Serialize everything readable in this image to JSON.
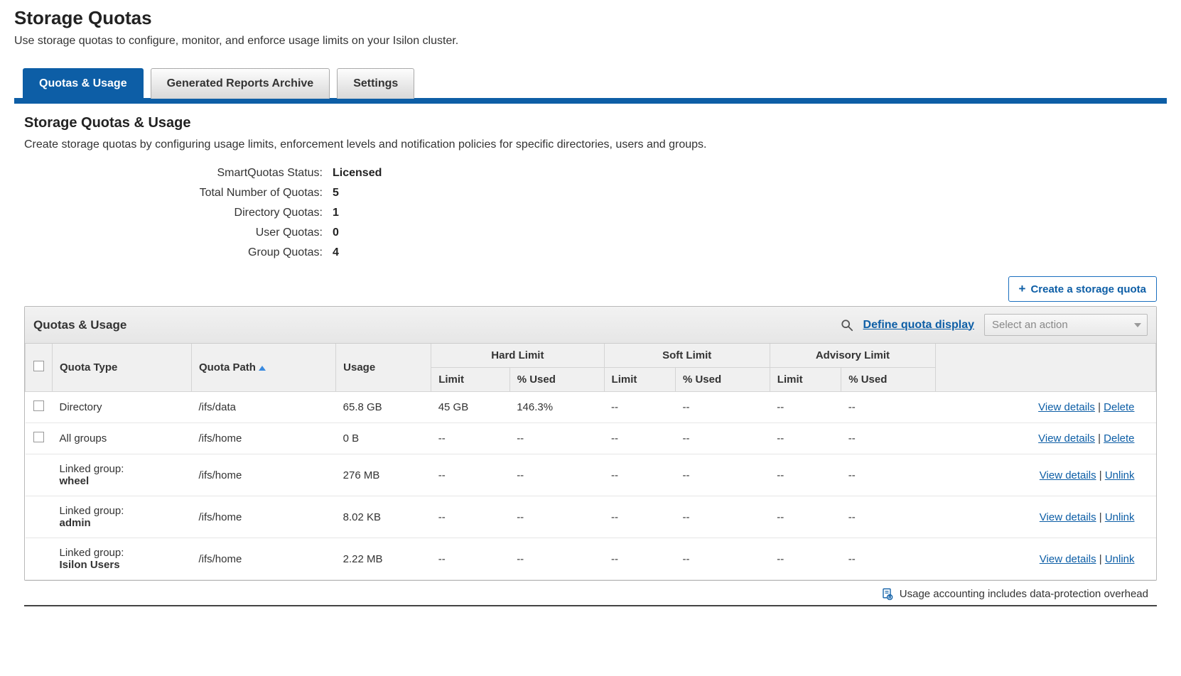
{
  "page": {
    "title": "Storage Quotas",
    "description": "Use storage quotas to configure, monitor, and enforce usage limits on your Isilon cluster."
  },
  "tabs": [
    {
      "label": "Quotas & Usage",
      "active": true
    },
    {
      "label": "Generated Reports Archive",
      "active": false
    },
    {
      "label": "Settings",
      "active": false
    }
  ],
  "section": {
    "heading": "Storage Quotas & Usage",
    "description": "Create storage quotas by configuring usage limits, enforcement levels and notification policies for specific directories, users and groups."
  },
  "stats": {
    "labels": {
      "status": "SmartQuotas Status:",
      "total": "Total Number of Quotas:",
      "directory": "Directory Quotas:",
      "user": "User Quotas:",
      "group": "Group Quotas:"
    },
    "values": {
      "status": "Licensed",
      "total": "5",
      "directory": "1",
      "user": "0",
      "group": "4"
    }
  },
  "buttons": {
    "create": "Create a storage quota"
  },
  "panel": {
    "title": "Quotas & Usage",
    "define_link": "Define quota display",
    "action_placeholder": "Select an action"
  },
  "columns": {
    "quota_type": "Quota Type",
    "quota_path": "Quota Path",
    "usage": "Usage",
    "hard": "Hard Limit",
    "soft": "Soft Limit",
    "advisory": "Advisory Limit",
    "limit": "Limit",
    "pct_used": "% Used"
  },
  "action_labels": {
    "view": "View details",
    "delete": "Delete",
    "unlink": "Unlink"
  },
  "rows": [
    {
      "selectable": true,
      "type_label": "Directory",
      "type_detail": "",
      "path": "/ifs/data",
      "usage": "65.8 GB",
      "hard_limit": "45 GB",
      "hard_pct": "146.3%",
      "soft_limit": "--",
      "soft_pct": "--",
      "adv_limit": "--",
      "adv_pct": "--",
      "secondary_action": "delete"
    },
    {
      "selectable": true,
      "type_label": "All groups",
      "type_detail": "",
      "path": "/ifs/home",
      "usage": "0 B",
      "hard_limit": "--",
      "hard_pct": "--",
      "soft_limit": "--",
      "soft_pct": "--",
      "adv_limit": "--",
      "adv_pct": "--",
      "secondary_action": "delete"
    },
    {
      "selectable": false,
      "type_label": "Linked group:",
      "type_detail": "wheel",
      "path": "/ifs/home",
      "usage": "276 MB",
      "hard_limit": "--",
      "hard_pct": "--",
      "soft_limit": "--",
      "soft_pct": "--",
      "adv_limit": "--",
      "adv_pct": "--",
      "secondary_action": "unlink"
    },
    {
      "selectable": false,
      "type_label": "Linked group:",
      "type_detail": "admin",
      "path": "/ifs/home",
      "usage": "8.02 KB",
      "hard_limit": "--",
      "hard_pct": "--",
      "soft_limit": "--",
      "soft_pct": "--",
      "adv_limit": "--",
      "adv_pct": "--",
      "secondary_action": "unlink"
    },
    {
      "selectable": false,
      "type_label": "Linked group:",
      "type_detail": "Isilon Users",
      "path": "/ifs/home",
      "usage": "2.22 MB",
      "hard_limit": "--",
      "hard_pct": "--",
      "soft_limit": "--",
      "soft_pct": "--",
      "adv_limit": "--",
      "adv_pct": "--",
      "secondary_action": "unlink"
    }
  ],
  "footer_note": "Usage accounting includes data-protection overhead"
}
